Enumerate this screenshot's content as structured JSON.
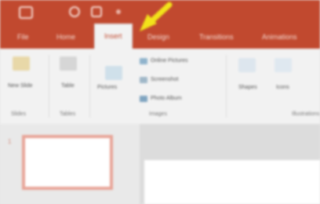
{
  "titlebar": {
    "quick_access": [
      "save-icon",
      "undo-icon",
      "redo-icon",
      "customize-icon"
    ],
    "color": "#c1492f"
  },
  "tabs": [
    {
      "label": "File"
    },
    {
      "label": "Home"
    },
    {
      "label": "Insert",
      "active": true
    },
    {
      "label": "Design"
    },
    {
      "label": "Transitions"
    },
    {
      "label": "Animations"
    }
  ],
  "ribbon": {
    "slides_group": {
      "new_slide": "New Slide",
      "label": "Slides"
    },
    "table_group": {
      "table": "Table",
      "label": "Tables"
    },
    "images_group": {
      "pictures": "Pictures",
      "online_pictures": "Online Pictures",
      "screenshot": "Screenshot",
      "photo_album": "Photo Album",
      "label": "Images"
    },
    "illustrations_group": {
      "shapes": "Shapes",
      "icons": "Icons",
      "label": "Illustrations"
    }
  },
  "thumbnails": [
    {
      "number": "1"
    }
  ],
  "annotation": {
    "arrow_color": "#f2e21a"
  }
}
